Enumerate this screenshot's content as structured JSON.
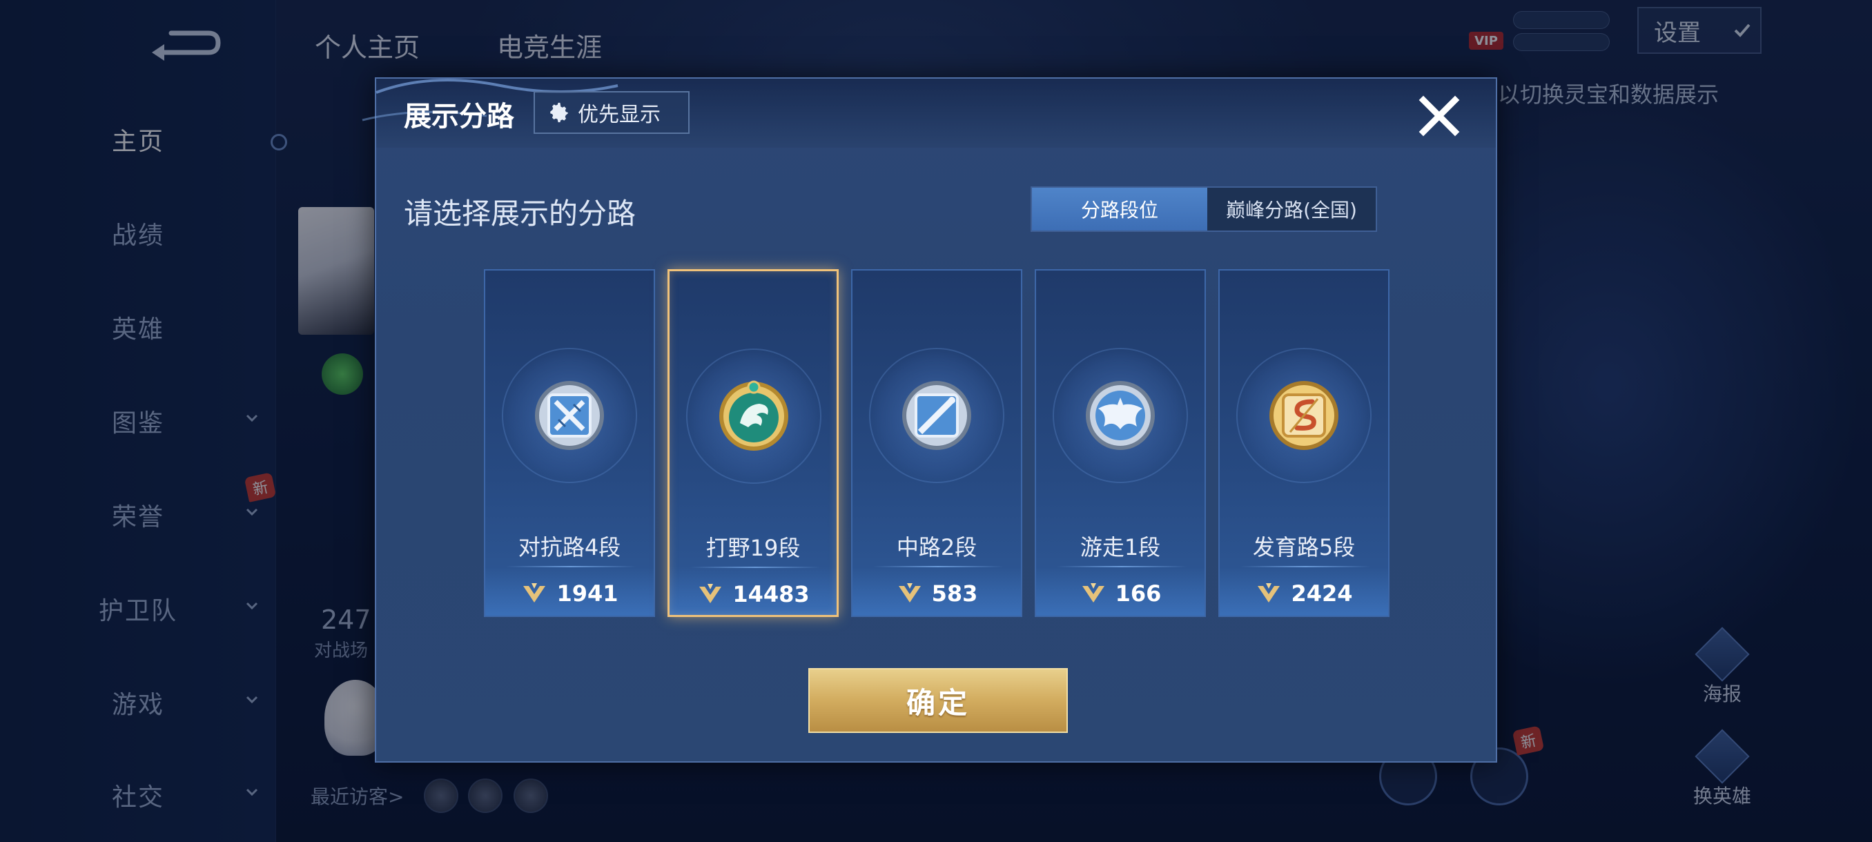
{
  "background": {
    "sidebar": {
      "items": [
        {
          "label": "主页",
          "active": true
        },
        {
          "label": "战绩"
        },
        {
          "label": "英雄"
        },
        {
          "label": "图鉴",
          "chevron": true
        },
        {
          "label": "荣誉",
          "chevron": true
        },
        {
          "label": "护卫队",
          "chevron": true
        },
        {
          "label": "游戏",
          "chevron": true
        },
        {
          "label": "社交",
          "chevron": true
        }
      ],
      "new_badge": "新"
    },
    "top_tabs": [
      "个人主页",
      "电竞生涯"
    ],
    "stat_value": "247",
    "stat_label": "对战场",
    "recent_visitors_label": "最近访客>",
    "vip_label": "VIP",
    "settings_label": "设置",
    "hint_text": "以切换灵宝和数据展示",
    "right_buttons": {
      "poster": "海报",
      "change_hero": "换英雄"
    },
    "new_badge2": "新"
  },
  "modal": {
    "title": "展示分路",
    "priority_label": "优先显示",
    "prompt": "请选择展示的分路",
    "segment": {
      "active": "分路段位",
      "inactive": "巅峰分路(全国)"
    },
    "cards": [
      {
        "title": "对抗路4段",
        "score": "1941",
        "badge": "silver-swords",
        "selected": false
      },
      {
        "title": "打野19段",
        "score": "14483",
        "badge": "jade-dragon",
        "selected": true
      },
      {
        "title": "中路2段",
        "score": "583",
        "badge": "silver-staff",
        "selected": false
      },
      {
        "title": "游走1段",
        "score": "166",
        "badge": "silver-wings",
        "selected": false
      },
      {
        "title": "发育路5段",
        "score": "2424",
        "badge": "gold-bow",
        "selected": false
      }
    ],
    "confirm_label": "确定"
  },
  "colors": {
    "accent_gold": "#d2ac5f",
    "selected_border": "#f0c27a",
    "segment_active": "#4f84c9",
    "modal_bg": "#2b4773"
  }
}
